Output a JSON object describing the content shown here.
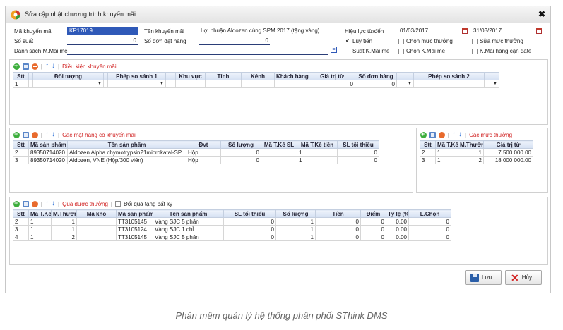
{
  "window": {
    "title": "Sửa cập nhật chương trình khuyến mãi"
  },
  "header": {
    "ma_km_label": "Mã khuyến mãi",
    "ma_km_value": "KP17019",
    "ten_km_label": "Tên khuyến mãi",
    "ten_km_value": "Lợi nhuận Aldozen cùng SPM 2017 (tặng vàng)",
    "hieu_luc_label": "Hiệu lực từ/đến",
    "tu_ngay": "01/03/2017",
    "den_ngay": "31/03/2017",
    "so_suat_label": "Số suất",
    "so_suat_value": "0",
    "so_don_label": "Số đơn đặt hàng",
    "so_don_value": "0",
    "ds_mamai_label": "Danh sách M.Mãi me",
    "lock_glyph": "=",
    "checks": [
      {
        "label": "Lũy tiến",
        "checked": true
      },
      {
        "label": "Chọn mức thưởng",
        "checked": false
      },
      {
        "label": "Sửa mức thưởng",
        "checked": false
      },
      {
        "label": "Suất K.Mãi me",
        "checked": false
      },
      {
        "label": "Chọn K.Mãi me",
        "checked": false
      },
      {
        "label": "K.Mãi hàng cận date",
        "checked": false
      }
    ]
  },
  "toolbar": {
    "separator": "|",
    "arrow_up": "↑",
    "arrow_down": "↓"
  },
  "conditions": {
    "title": "Điều kiện khuyến mãi",
    "columns": [
      "Stt",
      "",
      "Đối tượng",
      "",
      "Phép so sánh 1",
      "",
      "Khu vực",
      "Tỉnh",
      "Kênh",
      "Khách hàng",
      "Giá trị từ",
      "Số đơn hàng",
      "",
      "Phép so sánh 2",
      ""
    ],
    "rows": [
      [
        "1",
        "",
        "▼",
        "",
        "▼",
        "",
        "",
        "",
        "",
        "",
        "0",
        "0",
        "▼",
        "",
        "▼"
      ]
    ]
  },
  "items": {
    "title": "Các mặt hàng có khuyến mãi",
    "columns": [
      "Stt",
      "Mã sản phẩm",
      "Tên sản phẩm",
      "Đvt",
      "Số lượng",
      "Mã T.Kê SL",
      "Mã T.Kê tiền",
      "SL tối thiểu"
    ],
    "rows": [
      [
        "2",
        "89350714020",
        "Aldozen Alpha chymotrypsin21microkatal-SP",
        "Hộp",
        "0",
        "",
        "1",
        "0"
      ],
      [
        "3",
        "89350714020",
        "Aldozen, VNE (Hộp/300 viên)",
        "Hộp",
        "0",
        "",
        "1",
        "0"
      ]
    ]
  },
  "levels": {
    "title": "Các mức thưởng",
    "columns": [
      "Stt",
      "Mã T.Kê",
      "M.Thưởng",
      "Giá trị từ"
    ],
    "rows": [
      [
        "2",
        "1",
        "1",
        "7 500 000.00"
      ],
      [
        "3",
        "1",
        "2",
        "18 000 000.00"
      ]
    ]
  },
  "gifts": {
    "title": "Quà được thưởng",
    "toggle_label": "Đổi quà tặng bất kỳ",
    "columns": [
      "Stt",
      "Mã T.Kê",
      "M.Thưởng",
      "Mã kho",
      "Mã sản phẩm",
      "Tên sản phẩm",
      "SL tối thiểu",
      "Số lượng",
      "Tiền",
      "Điểm",
      "Tỷ lệ (%)",
      "L.Chọn"
    ],
    "rows": [
      [
        "2",
        "1",
        "1",
        "",
        "TT3105145",
        "Vàng SJC 5 phân",
        "0",
        "1",
        "0",
        "0",
        "0.00",
        "0"
      ],
      [
        "3",
        "1",
        "1",
        "",
        "TT3105124",
        "Vàng SJC 1 chỉ",
        "0",
        "1",
        "0",
        "0",
        "0.00",
        "0"
      ],
      [
        "4",
        "1",
        "2",
        "",
        "TT3105145",
        "Vàng SJC 5 phân",
        "0",
        "1",
        "0",
        "0",
        "0.00",
        "0"
      ]
    ]
  },
  "buttons": {
    "save": "Lưu",
    "cancel": "Hủy"
  },
  "caption": "Phần mềm quản lý hệ thống phân phối SThink DMS",
  "colors": {
    "accent": "#2f59b8",
    "section_title": "#d02020",
    "grid_header": "#d5e0f2"
  },
  "icons": {
    "close": "close-icon",
    "save": "floppy-icon",
    "cancel": "x-icon"
  }
}
